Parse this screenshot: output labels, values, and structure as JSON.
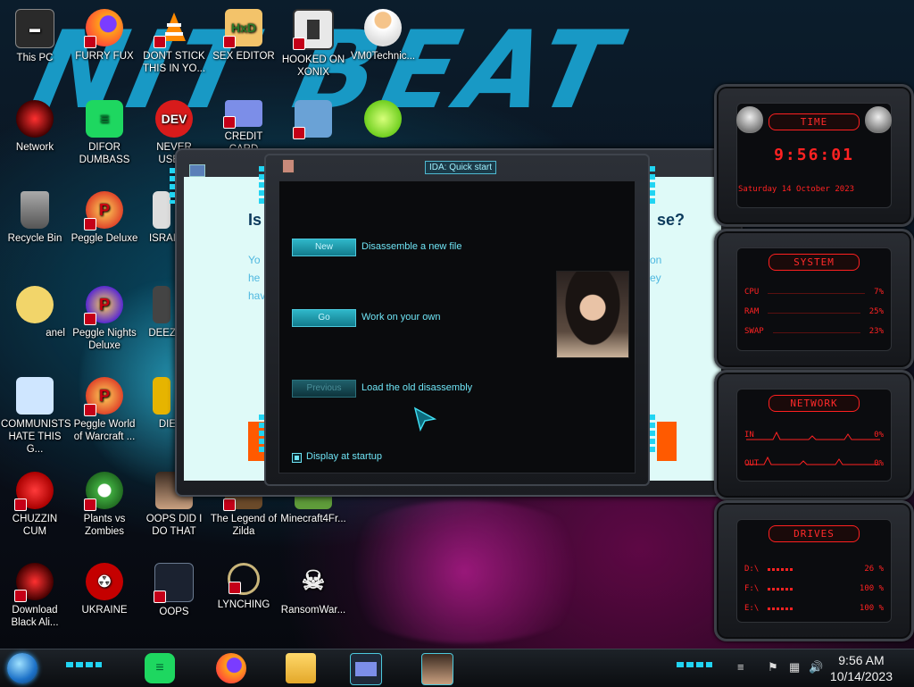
{
  "wallpaper": {
    "text": "NIT BEAT"
  },
  "desktop_icons": [
    {
      "label": "This PC"
    },
    {
      "label": "FURRY FUX"
    },
    {
      "label": "DONT STICK THIS IN YO..."
    },
    {
      "label": "SEX EDITOR"
    },
    {
      "label": "HOOKED ON XONIX"
    },
    {
      "label": "VM0Technic..."
    },
    {
      "label": "Network"
    },
    {
      "label": "DIFOR DUMBASS"
    },
    {
      "label": "NEVER USED!"
    },
    {
      "label": "CREDIT CARD"
    },
    {
      "label": "Recycle Bin"
    },
    {
      "label": "Peggle Deluxe"
    },
    {
      "label": "ISRAI"
    },
    {
      "label": "anel"
    },
    {
      "label": "Peggle Nights Deluxe"
    },
    {
      "label": "DEEZ"
    },
    {
      "label": "COMMUNISTS HATE THIS G..."
    },
    {
      "label": "Peggle World of Warcraft ..."
    },
    {
      "label": "DIE"
    },
    {
      "label": "CHUZZIN CUM"
    },
    {
      "label": "Plants vs Zombies"
    },
    {
      "label": "OOPS DID I DO THAT"
    },
    {
      "label": "The Legend of Zilda"
    },
    {
      "label": "Minecraft4Fr..."
    },
    {
      "label": "Download Black Ali..."
    },
    {
      "label": "UKRAINE"
    },
    {
      "label": "OOPS"
    },
    {
      "label": "LYNCHING"
    },
    {
      "label": "RansomWar..."
    }
  ],
  "ida_window": {
    "background_doc": {
      "question_left": "Is",
      "question_right": "se?",
      "text_lines_left": [
        "Yo",
        "he",
        "hav"
      ],
      "text_lines_right": [
        "on",
        "ey"
      ]
    },
    "dialog": {
      "title": "IDA: Quick start",
      "buttons": [
        {
          "label": "New",
          "description": "Disassemble a new file",
          "enabled": true
        },
        {
          "label": "Go",
          "description": "Work on your own",
          "enabled": true
        },
        {
          "label": "Previous",
          "description": "Load the old disassembly",
          "enabled": false
        }
      ],
      "checkbox": {
        "label": "Display at startup",
        "checked": true
      }
    }
  },
  "gadgets": {
    "time": {
      "title": "TIME",
      "clock": "9:56:01",
      "date": "Saturday 14 October 2023"
    },
    "system": {
      "title": "SYSTEM",
      "rows": [
        {
          "label": "CPU",
          "value": "7%"
        },
        {
          "label": "RAM",
          "value": "25%"
        },
        {
          "label": "SWAP",
          "value": "23%"
        }
      ]
    },
    "network": {
      "title": "NETWORK",
      "rows": [
        {
          "label": "IN",
          "value": "0%"
        },
        {
          "label": "OUT",
          "value": "0%"
        }
      ]
    },
    "drives": {
      "title": "DRIVES",
      "rows": [
        {
          "label": "D:\\",
          "value": "26 %"
        },
        {
          "label": "F:\\",
          "value": "100 %"
        },
        {
          "label": "E:\\",
          "value": "100 %"
        }
      ]
    }
  },
  "taskbar": {
    "clock_time": "9:56 AM",
    "clock_date": "10/14/2023",
    "colors": {
      "accent": "#21d4f2",
      "gadget_red": "#ff2222"
    }
  }
}
